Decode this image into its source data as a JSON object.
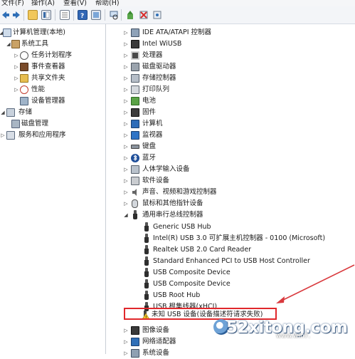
{
  "menu": {
    "items": [
      "文件(F)",
      "操作(A)",
      "查看(V)",
      "帮助(H)"
    ]
  },
  "toolbar": {
    "buttons": [
      "back-icon",
      "forward-icon",
      "up-folder-icon",
      "show-hide-tree-icon",
      "properties-icon",
      "help-icon",
      "extra-view-icon",
      "scan-hardware-icon",
      "update-driver-icon",
      "disable-device-icon",
      "uninstall-device-icon"
    ]
  },
  "left_tree": {
    "items": [
      {
        "label": "计算机管理(本地)",
        "icon": "computer-management-icon"
      },
      {
        "label": "系统工具",
        "icon": "tools-icon"
      },
      {
        "label": "任务计划程序",
        "icon": "clock-icon"
      },
      {
        "label": "事件查看器",
        "icon": "event-viewer-icon"
      },
      {
        "label": "共享文件夹",
        "icon": "shared-folder-icon"
      },
      {
        "label": "性能",
        "icon": "performance-icon"
      },
      {
        "label": "设备管理器",
        "icon": "device-manager-icon"
      },
      {
        "label": "存储",
        "icon": "storage-icon"
      },
      {
        "label": "磁盘管理",
        "icon": "disk-management-icon"
      },
      {
        "label": "服务和应用程序",
        "icon": "services-icon"
      }
    ]
  },
  "device_tree": {
    "categories": [
      {
        "label": "IDE ATA/ATAPI 控制器",
        "icon": "ide-controller-icon"
      },
      {
        "label": "Intel WiUSB",
        "icon": "wiusb-icon"
      },
      {
        "label": "处理器",
        "icon": "processor-icon"
      },
      {
        "label": "磁盘驱动器",
        "icon": "disk-drive-icon"
      },
      {
        "label": "存储控制器",
        "icon": "storage-controller-icon"
      },
      {
        "label": "打印队列",
        "icon": "printer-icon"
      },
      {
        "label": "电池",
        "icon": "battery-icon"
      },
      {
        "label": "固件",
        "icon": "firmware-icon"
      },
      {
        "label": "计算机",
        "icon": "computer-icon"
      },
      {
        "label": "监视器",
        "icon": "monitor-icon"
      },
      {
        "label": "键盘",
        "icon": "keyboard-icon"
      },
      {
        "label": "蓝牙",
        "icon": "bluetooth-icon"
      },
      {
        "label": "人体学输入设备",
        "icon": "hid-icon"
      },
      {
        "label": "软件设备",
        "icon": "software-device-icon"
      },
      {
        "label": "声音、视频和游戏控制器",
        "icon": "sound-icon"
      },
      {
        "label": "鼠标和其他指针设备",
        "icon": "mouse-icon"
      },
      {
        "label": "通用串行总线控制器",
        "icon": "usb-controller-icon",
        "expanded": true
      }
    ],
    "usb_children": [
      "Generic USB Hub",
      "Intel(R) USB 3.0 可扩展主机控制器 - 0100 (Microsoft)",
      "Realtek USB 2.0 Card Reader",
      "Standard Enhanced PCI to USB Host Controller",
      "USB Composite Device",
      "USB Composite Device",
      "USB Root Hub",
      "USB 根集线器(xHCI)"
    ],
    "unknown_device": {
      "label": "未知 USB 设备(设备描述符请求失败)",
      "icon": "warning-usb-icon"
    },
    "after": [
      {
        "label": "图像设备",
        "icon": "imaging-icon"
      },
      {
        "label": "网络适配器",
        "icon": "network-adapter-icon"
      },
      {
        "label": "系统设备",
        "icon": "system-device-icon"
      }
    ]
  },
  "watermark": {
    "text": "52xitong.com",
    "sub": "www.win7."
  },
  "colors": {
    "highlight": "#e0282c",
    "annotation_arrow": "#d93a3e"
  }
}
